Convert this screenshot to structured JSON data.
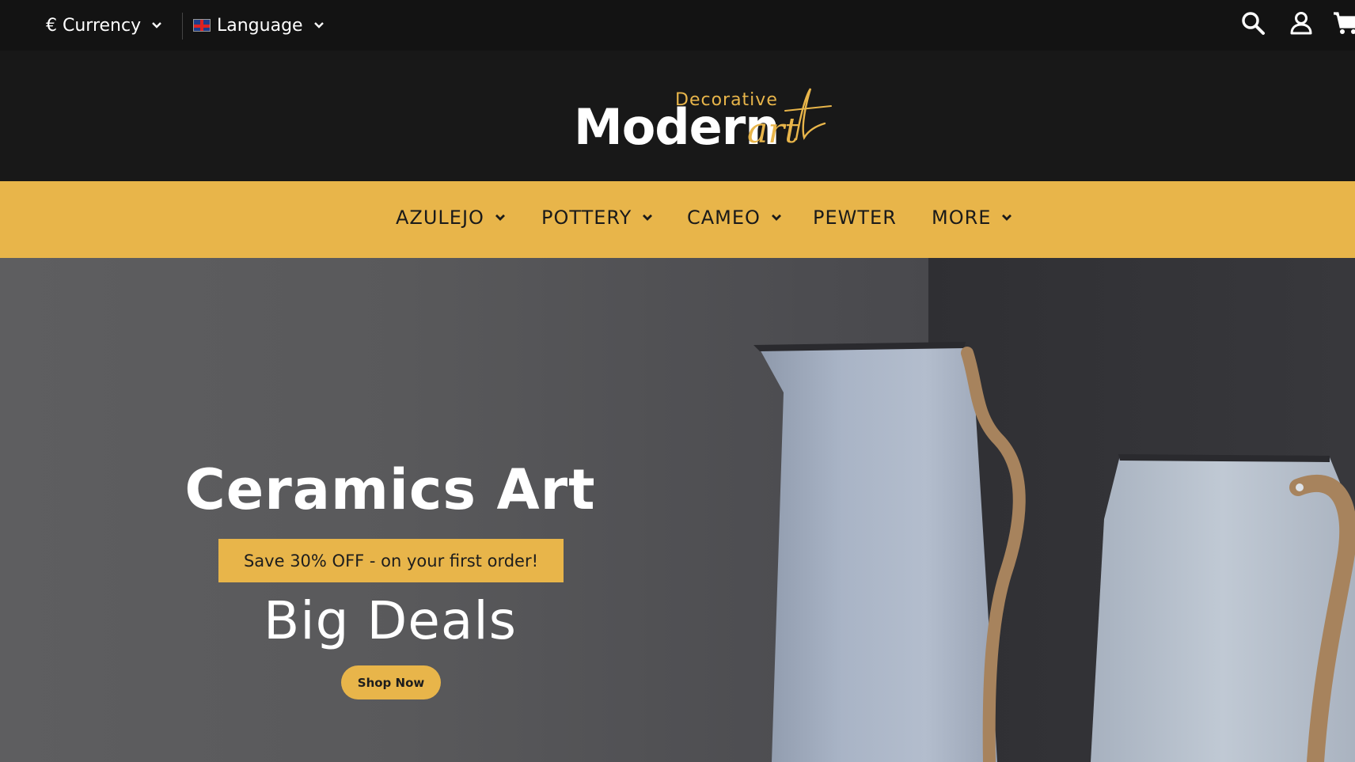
{
  "topbar": {
    "currency_label": "€ Currency",
    "language_label": "Language",
    "icons": [
      "search-icon",
      "user-icon",
      "cart-icon"
    ]
  },
  "logo": {
    "main": "Modern",
    "decorative": "Decorative",
    "script": "art"
  },
  "nav": {
    "items": [
      {
        "label": "AZULEJO",
        "dropdown": true
      },
      {
        "label": "POTTERY",
        "dropdown": true
      },
      {
        "label": "CAMEO",
        "dropdown": true
      },
      {
        "label": "PEWTER",
        "dropdown": false
      },
      {
        "label": "MORE",
        "dropdown": true
      }
    ]
  },
  "hero": {
    "title": "Ceramics Art",
    "promo": "Save 30% OFF - on your first order!",
    "subtitle": "Big Deals",
    "cta": "Shop Now"
  },
  "colors": {
    "accent": "#e8b54a",
    "topbar_bg": "#131313",
    "header_bg": "#181818",
    "hero_bg": "#58585a"
  }
}
